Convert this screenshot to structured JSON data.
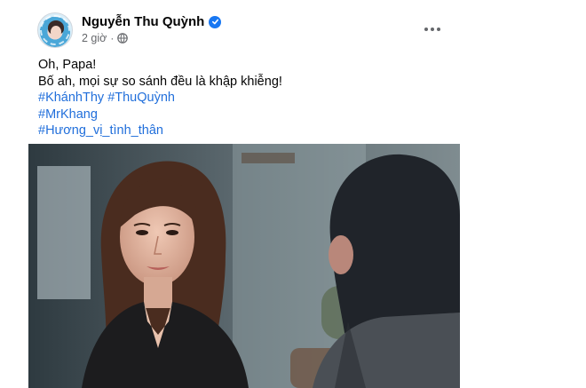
{
  "post": {
    "author": "Nguyễn Thu Quỳnh",
    "time": "2 giờ",
    "separator": "·",
    "text_lines": [
      "Oh, Papa!",
      "Bố ah, mọi sự so sánh đều là khập khiễng!"
    ],
    "hashtags": [
      "#KhánhThy #ThuQuỳnh",
      "#MrKhang",
      "#Hương_vị_tình_thân"
    ],
    "icons": {
      "verified": "verified-badge-icon",
      "audience": "globe-icon",
      "more": "more-options-icon"
    }
  },
  "colors": {
    "hashtag": "#216fdb",
    "verified": "#1877f2",
    "secondary_text": "#65676b"
  }
}
